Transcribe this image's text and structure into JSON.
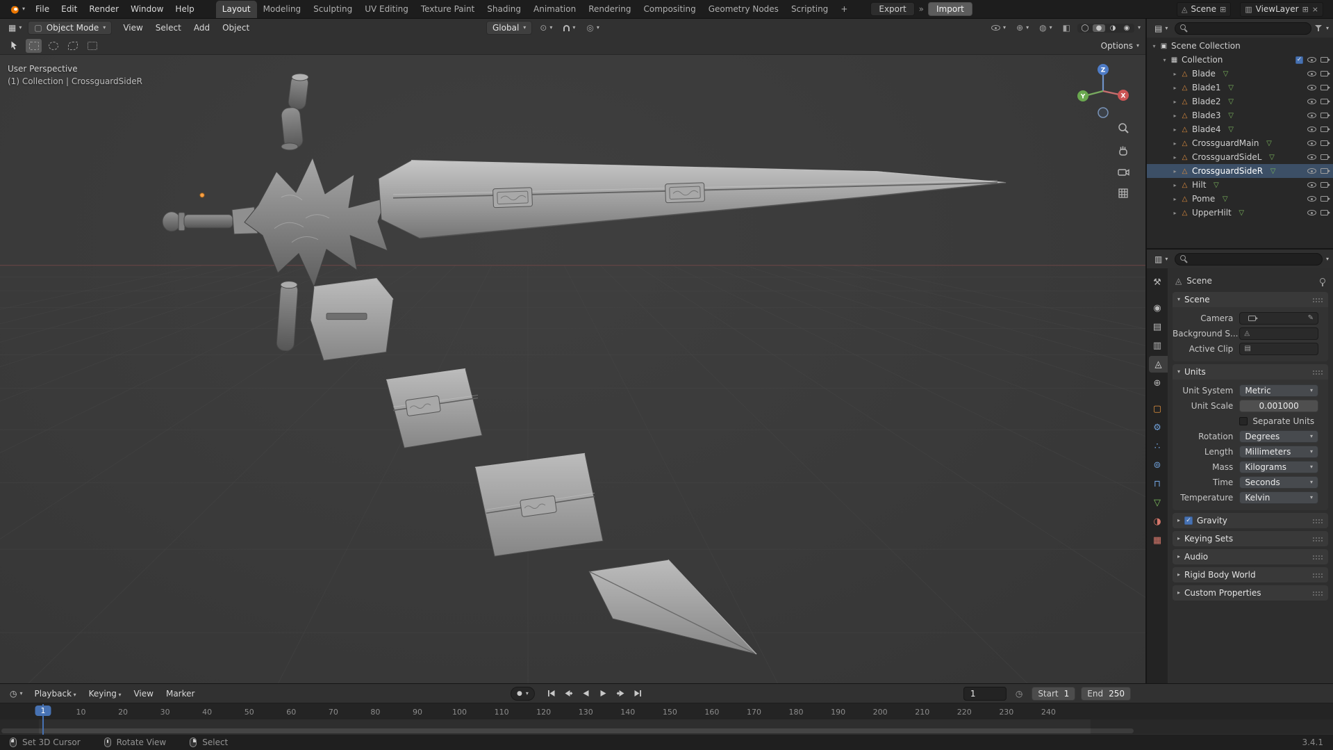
{
  "icons": {
    "dropdown-caret": "▾",
    "expand-open": "▾",
    "expand-closed": "▸",
    "check": "✓",
    "chevrons": "»",
    "close": "×",
    "editor-3d-viewport": "▦",
    "editor-outliner": "▤",
    "editor-properties": "▥",
    "editor-timeline": "◷",
    "object-mode": "▢",
    "pivot": "⊙",
    "proportional": "◎",
    "visibility": "◉",
    "gizmo": "⊕",
    "overlays": "◍",
    "xray": "◧",
    "shade-wire": "◯",
    "shade-solid": "●",
    "shade-material": "◑",
    "shade-render": "◉",
    "scene": "◬",
    "viewlayer": "▥",
    "new-page": "⊞",
    "scene-collection": "▣",
    "collection": "▦",
    "mesh-object": "△",
    "mesh-data": "▽",
    "record": "●",
    "clock": "◷",
    "clip": "▤",
    "eyedropper": "✎",
    "tab-tool": "⚒",
    "tab-render": "◉",
    "tab-output": "▤",
    "tab-view-layer": "▥",
    "tab-scene": "◬",
    "tab-world": "⊕",
    "tab-object": "▢",
    "tab-modifiers": "⚙",
    "tab-particles": "∴",
    "tab-physics": "⊚",
    "tab-constraints": "⊓",
    "tab-data": "▽",
    "tab-material": "◑",
    "tab-texture": "▦"
  },
  "topbar": {
    "menus": [
      "File",
      "Edit",
      "Render",
      "Window",
      "Help"
    ],
    "workspaces": [
      "Layout",
      "Modeling",
      "Sculpting",
      "UV Editing",
      "Texture Paint",
      "Shading",
      "Animation",
      "Rendering",
      "Compositing",
      "Geometry Nodes",
      "Scripting"
    ],
    "active_workspace": "Layout",
    "add_tab": "+",
    "export_label": "Export",
    "import_label": "Import",
    "scene_name": "Scene",
    "view_layer_name": "ViewLayer"
  },
  "viewport": {
    "mode": "Object Mode",
    "menus": [
      "View",
      "Select",
      "Add",
      "Object"
    ],
    "orientation": "Global",
    "options_label": "Options",
    "overlay_perspective": "User Perspective",
    "overlay_context": "(1) Collection | CrossguardSideR",
    "gizmo": {
      "x": "X",
      "y": "Y",
      "z": "Z"
    }
  },
  "outliner": {
    "rows": [
      {
        "name": "Scene Collection",
        "icon": "scene-collection",
        "indent": 0,
        "expander": "open",
        "right": []
      },
      {
        "name": "Collection",
        "icon": "collection",
        "indent": 1,
        "expander": "open",
        "checkbox": true,
        "right": [
          "eye",
          "camera"
        ]
      },
      {
        "name": "Blade",
        "icon": "mesh-object",
        "indent": 2,
        "expander": "closed",
        "data_icon": true,
        "right": [
          "eye",
          "camera"
        ]
      },
      {
        "name": "Blade1",
        "icon": "mesh-object",
        "indent": 2,
        "expander": "closed",
        "data_icon": true,
        "right": [
          "eye",
          "camera"
        ]
      },
      {
        "name": "Blade2",
        "icon": "mesh-object",
        "indent": 2,
        "expander": "closed",
        "data_icon": true,
        "right": [
          "eye",
          "camera"
        ]
      },
      {
        "name": "Blade3",
        "icon": "mesh-object",
        "indent": 2,
        "expander": "closed",
        "data_icon": true,
        "right": [
          "eye",
          "camera"
        ]
      },
      {
        "name": "Blade4",
        "icon": "mesh-object",
        "indent": 2,
        "expander": "closed",
        "data_icon": true,
        "right": [
          "eye",
          "camera"
        ]
      },
      {
        "name": "CrossguardMain",
        "icon": "mesh-object",
        "indent": 2,
        "expander": "closed",
        "data_icon": true,
        "right": [
          "eye",
          "camera"
        ]
      },
      {
        "name": "CrossguardSideL",
        "icon": "mesh-object",
        "indent": 2,
        "expander": "closed",
        "data_icon": true,
        "right": [
          "eye",
          "camera"
        ]
      },
      {
        "name": "CrossguardSideR",
        "icon": "mesh-object",
        "indent": 2,
        "expander": "closed",
        "data_icon": true,
        "selected": true,
        "right": [
          "eye",
          "camera"
        ]
      },
      {
        "name": "Hilt",
        "icon": "mesh-object",
        "indent": 2,
        "expander": "closed",
        "data_icon": true,
        "right": [
          "eye",
          "camera"
        ]
      },
      {
        "name": "Pome",
        "icon": "mesh-object",
        "indent": 2,
        "expander": "closed",
        "data_icon": true,
        "right": [
          "eye",
          "camera"
        ]
      },
      {
        "name": "UpperHilt",
        "icon": "mesh-object",
        "indent": 2,
        "expander": "closed",
        "data_icon": true,
        "right": [
          "eye",
          "camera"
        ]
      }
    ]
  },
  "properties": {
    "tabs": [
      {
        "id": "tool",
        "icon": "tab-tool",
        "color": "#b8b8b8"
      },
      {
        "id": "render",
        "icon": "tab-render",
        "color": "#b8b8b8",
        "gap": true
      },
      {
        "id": "output",
        "icon": "tab-output",
        "color": "#b8b8b8"
      },
      {
        "id": "view-layer",
        "icon": "tab-view-layer",
        "color": "#b8b8b8"
      },
      {
        "id": "scene",
        "icon": "tab-scene",
        "color": "#e4e4e4",
        "active": true
      },
      {
        "id": "world",
        "icon": "tab-world",
        "color": "#b8b8b8"
      },
      {
        "id": "object",
        "icon": "tab-object",
        "color": "#e0923f",
        "gap": true
      },
      {
        "id": "modifiers",
        "icon": "tab-modifiers",
        "color": "#6f9fd8"
      },
      {
        "id": "particles",
        "icon": "tab-particles",
        "color": "#6f9fd8"
      },
      {
        "id": "physics",
        "icon": "tab-physics",
        "color": "#6f9fd8"
      },
      {
        "id": "constraints",
        "icon": "tab-constraints",
        "color": "#6f9fd8"
      },
      {
        "id": "data",
        "icon": "tab-data",
        "color": "#7fbf5f"
      },
      {
        "id": "material",
        "icon": "tab-material",
        "color": "#d4766a"
      },
      {
        "id": "texture",
        "icon": "tab-texture",
        "color": "#d4766a"
      }
    ],
    "breadcrumb": "Scene",
    "scene_panel": {
      "title": "Scene",
      "rows": [
        {
          "label": "Camera",
          "icon": "camera",
          "eyedropper": true
        },
        {
          "label": "Background S...",
          "icon": "scene"
        },
        {
          "label": "Active Clip",
          "icon": "clip"
        }
      ]
    },
    "units_panel": {
      "title": "Units",
      "rows": [
        {
          "label": "Unit System",
          "value": "Metric",
          "widget": "dropdown"
        },
        {
          "label": "Unit Scale",
          "value": "0.001000",
          "widget": "number"
        },
        {
          "label": "",
          "value": "Separate Units",
          "widget": "checkbox",
          "checked": false
        },
        {
          "label": "Rotation",
          "value": "Degrees",
          "widget": "dropdown"
        },
        {
          "label": "Length",
          "value": "Millimeters",
          "widget": "dropdown"
        },
        {
          "label": "Mass",
          "value": "Kilograms",
          "widget": "dropdown"
        },
        {
          "label": "Time",
          "value": "Seconds",
          "widget": "dropdown"
        },
        {
          "label": "Temperature",
          "value": "Kelvin",
          "widget": "dropdown"
        }
      ]
    },
    "collapsed_panels": [
      {
        "title": "Gravity",
        "checkbox": true,
        "checked": true
      },
      {
        "title": "Keying Sets"
      },
      {
        "title": "Audio"
      },
      {
        "title": "Rigid Body World"
      },
      {
        "title": "Custom Properties"
      }
    ]
  },
  "timeline": {
    "menus": [
      {
        "label": "Playback",
        "caret": true
      },
      {
        "label": "Keying",
        "caret": true
      },
      {
        "label": "View",
        "caret": false
      },
      {
        "label": "Marker",
        "caret": false
      }
    ],
    "current_frame": "1",
    "start_label": "Start",
    "start_value": "1",
    "end_label": "End",
    "end_value": "250",
    "ticks": [
      10,
      20,
      30,
      40,
      50,
      60,
      70,
      80,
      90,
      100,
      110,
      120,
      130,
      140,
      150,
      160,
      170,
      180,
      190,
      200,
      210,
      220,
      230,
      240
    ]
  },
  "statusbar": {
    "hints": [
      {
        "mouse": "left",
        "label": "Set 3D Cursor"
      },
      {
        "mouse": "middle",
        "label": "Rotate View"
      },
      {
        "mouse": "right",
        "label": "Select"
      }
    ],
    "version": "3.4.1"
  }
}
